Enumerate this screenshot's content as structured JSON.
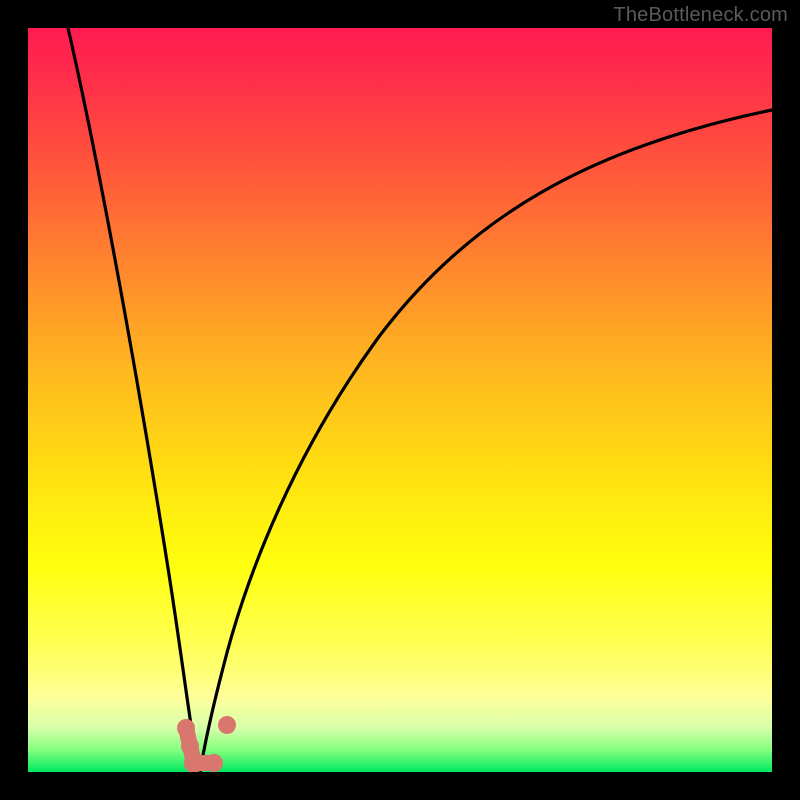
{
  "watermark": "TheBottleneck.com",
  "chart_data": {
    "type": "line",
    "title": "",
    "xlabel": "",
    "ylabel": "",
    "xlim": [
      0,
      100
    ],
    "ylim": [
      0,
      100
    ],
    "grid": false,
    "note": "Two curves descending to a common minimum near x≈22 then rising. Values are estimated from pixel positions (image has no numeric axes).",
    "series": [
      {
        "name": "left-branch",
        "x": [
          5,
          8,
          11,
          14,
          17,
          19,
          21,
          22,
          23
        ],
        "y": [
          100,
          82,
          62,
          42,
          24,
          13,
          5,
          2,
          0
        ]
      },
      {
        "name": "right-branch",
        "x": [
          23,
          24,
          26,
          29,
          34,
          41,
          50,
          62,
          78,
          100
        ],
        "y": [
          0,
          3,
          10,
          22,
          38,
          54,
          67,
          77,
          84,
          89
        ]
      }
    ],
    "annotations": [
      {
        "name": "min-marker-cluster",
        "approx_x": 22,
        "approx_y": 1,
        "color": "#d9766d"
      }
    ]
  }
}
